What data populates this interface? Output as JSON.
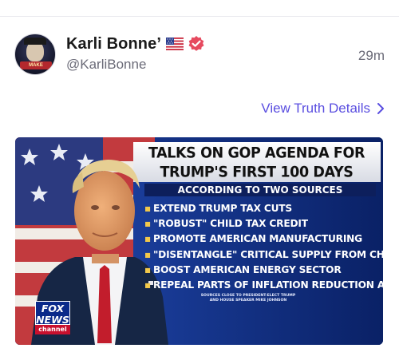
{
  "post": {
    "display_name": "Karli Bonne’",
    "handle": "@KarliBonne",
    "timestamp": "29m",
    "view_details_label": "View Truth Details"
  },
  "avatar": {
    "banner_text": "MAKE"
  },
  "icons": {
    "flag": "us-flag-icon",
    "verified": "verified-badge-icon",
    "chevron": "chevron-right-icon"
  },
  "colors": {
    "accent": "#5a4ee0",
    "verified": "#e64a5f",
    "graphic_blue": "#0f2a6e",
    "fox_red": "#c8102e"
  },
  "graphic": {
    "title_line1": "TALKS ON GOP AGENDA FOR",
    "title_line2": "TRUMP'S FIRST 100 DAYS",
    "subtitle": "ACCORDING TO TWO SOURCES",
    "items": [
      "EXTEND TRUMP TAX CUTS",
      "\"ROBUST\" CHILD TAX CREDIT",
      "PROMOTE AMERICAN MANUFACTURING",
      "\"DISENTANGLE\" CRITICAL SUPPLY FROM CHINA",
      "BOOST AMERICAN ENERGY SECTOR",
      "REPEAL PARTS OF INFLATION REDUCTION ACT"
    ],
    "source_line1": "SOURCES CLOSE TO PRESIDENT-ELECT TRUMP",
    "source_line2": "AND HOUSE SPEAKER MIKE JOHNSON",
    "logo_line1": "FOX",
    "logo_line2": "NEWS",
    "logo_line3": "channel"
  }
}
